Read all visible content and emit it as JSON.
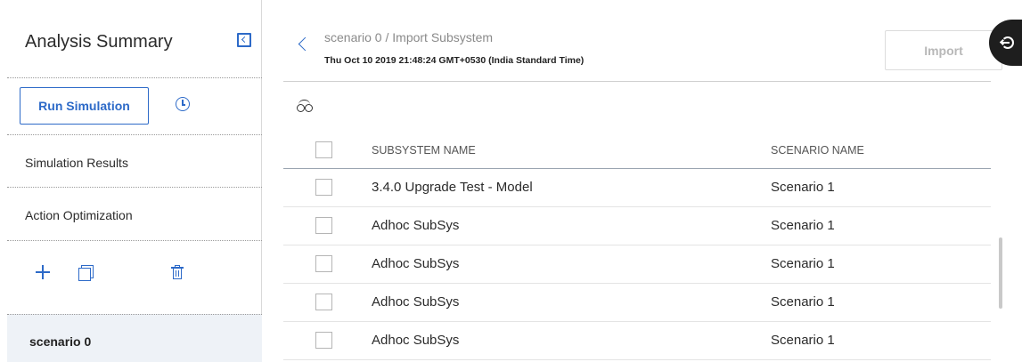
{
  "sidebar": {
    "title": "Analysis Summary",
    "run_button_label": "Run Simulation",
    "items": [
      {
        "label": "Simulation Results"
      },
      {
        "label": "Action Optimization"
      }
    ],
    "selected_scenario": "scenario 0"
  },
  "header": {
    "breadcrumb": "scenario 0 / Import Subsystem",
    "timestamp": "Thu Oct 10 2019 21:48:24 GMT+0530 (India Standard Time)",
    "import_label": "Import"
  },
  "table": {
    "columns": [
      "SUBSYSTEM NAME",
      "SCENARIO NAME"
    ],
    "rows": [
      {
        "subsystem": "3.4.0 Upgrade Test - Model",
        "scenario": "Scenario 1"
      },
      {
        "subsystem": "Adhoc SubSys",
        "scenario": "Scenario 1"
      },
      {
        "subsystem": "Adhoc SubSys",
        "scenario": "Scenario 1"
      },
      {
        "subsystem": "Adhoc SubSys",
        "scenario": "Scenario 1"
      },
      {
        "subsystem": "Adhoc SubSys",
        "scenario": "Scenario 1"
      }
    ]
  },
  "icons": {
    "collapse": "collapse-panel-icon",
    "history": "history-icon",
    "add": "plus-icon",
    "copy": "copy-icon",
    "delete": "trash-icon",
    "back": "chevron-left-icon",
    "search": "binoculars-icon",
    "exit": "exit-icon"
  },
  "colors": {
    "accent": "#2d6ac8",
    "selected_bg": "#eef2f7",
    "disabled_text": "#b8b8b8"
  }
}
